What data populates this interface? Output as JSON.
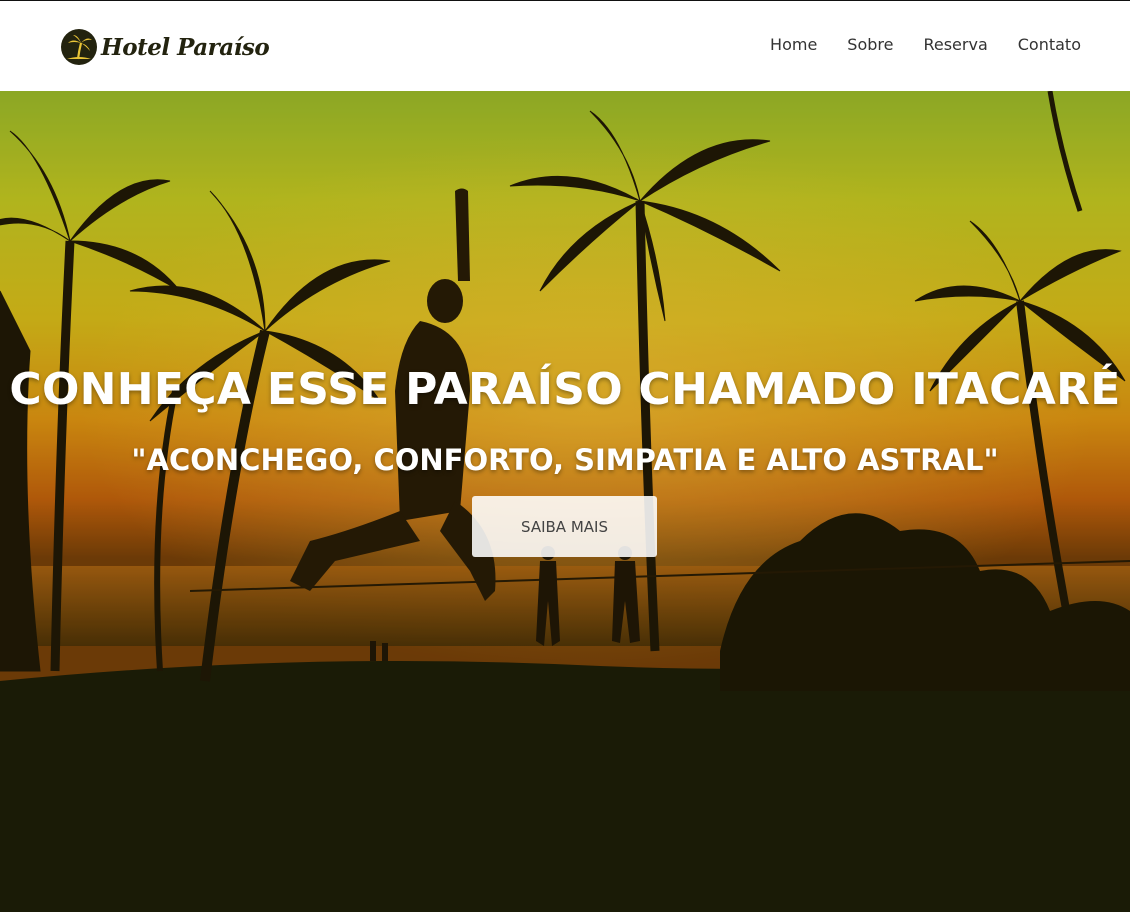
{
  "brand": {
    "name": "Hotel Paraíso",
    "logo_icon": "palm-tree-icon"
  },
  "nav": {
    "items": [
      {
        "label": "Home"
      },
      {
        "label": "Sobre"
      },
      {
        "label": "Reserva"
      },
      {
        "label": "Contato"
      }
    ]
  },
  "hero": {
    "title": "CONHEÇA ESSE PARAÍSO CHAMADO ITACARÉ",
    "subtitle": "\"ACONCHEGO, CONFORTO, SIMPATIA E ALTO ASTRAL\"",
    "button_label": "SAIBA MAIS"
  },
  "colors": {
    "header_bg": "#ffffff",
    "brand_dark": "#23230f",
    "hero_dark": "#1e1f07",
    "sky_yellow": "#d9d21a",
    "sunset_orange": "#e07a0c"
  }
}
